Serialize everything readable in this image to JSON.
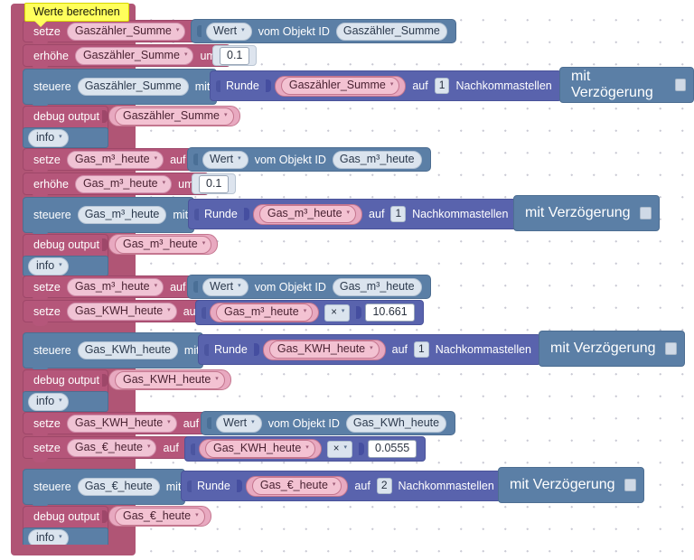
{
  "workspace": {
    "tooltip": "Werte berechnen",
    "colors": {
      "variable_block": "#b5567a",
      "control_block": "#5b7fa6",
      "math_block": "#5963ad",
      "variable_field": "#f0c3d4",
      "object_field": "#dbe4ee",
      "tooltip_bg": "#ffff5c",
      "canvas_bg": "#ffffff"
    },
    "caret_glyph": "▾",
    "multiply_glyph": "×"
  },
  "labels": {
    "setze": "setze",
    "erhoehe": "erhöhe",
    "steuere": "steuere",
    "debug_output": "debug output",
    "auf": "auf",
    "um": "um",
    "mit": "mit",
    "wert": "Wert",
    "vom_objekt_id": "vom Objekt ID",
    "runde": "Runde",
    "auf_nachkomma_pre": "auf",
    "nachkommastellen": "Nachkommastellen",
    "mit_verzoegerung": "mit Verzögerung",
    "info": "info"
  },
  "rows": [
    {
      "id": "row-1",
      "type": "setze-object",
      "variable": "Gaszähler_Summe",
      "value_source": "Wert",
      "object_id": "Gaszähler_Summe"
    },
    {
      "id": "row-2",
      "type": "erhoehe",
      "variable": "Gaszähler_Summe",
      "amount": "0.1"
    },
    {
      "id": "row-3",
      "type": "steuere-runde",
      "variable": "Gaszähler_Summe",
      "round_variable": "Gaszähler_Summe",
      "decimals": "1",
      "delay_checked": false
    },
    {
      "id": "row-4",
      "type": "debug",
      "variable": "Gaszähler_Summe",
      "level": "info"
    },
    {
      "id": "row-5",
      "type": "setze-object",
      "variable": "Gas_m³_heute",
      "value_source": "Wert",
      "object_id": "Gas_m³_heute"
    },
    {
      "id": "row-6",
      "type": "erhoehe",
      "variable": "Gas_m³_heute",
      "amount": "0.1"
    },
    {
      "id": "row-7",
      "type": "steuere-runde",
      "variable": "Gas_m³_heute",
      "round_variable": "Gas_m³_heute",
      "decimals": "1",
      "delay_checked": false
    },
    {
      "id": "row-8",
      "type": "debug",
      "variable": "Gas_m³_heute",
      "level": "info"
    },
    {
      "id": "row-9",
      "type": "setze-object",
      "variable": "Gas_m³_heute",
      "value_source": "Wert",
      "object_id": "Gas_m³_heute"
    },
    {
      "id": "row-10",
      "type": "setze-math",
      "variable": "Gas_KWH_heute",
      "operand_a": "Gas_m³_heute",
      "operator": "×",
      "operand_b": "10.661"
    },
    {
      "id": "row-11",
      "type": "steuere-runde",
      "variable": "Gas_KWh_heute",
      "round_variable": "Gas_KWH_heute",
      "decimals": "1",
      "delay_checked": false
    },
    {
      "id": "row-12",
      "type": "debug",
      "variable": "Gas_KWH_heute",
      "level": "info"
    },
    {
      "id": "row-13",
      "type": "setze-object",
      "variable": "Gas_KWH_heute",
      "value_source": "Wert",
      "object_id": "Gas_KWh_heute"
    },
    {
      "id": "row-14",
      "type": "setze-math",
      "variable": "Gas_€_heute",
      "operand_a": "Gas_KWH_heute",
      "operator": "×",
      "operand_b": "0.0555"
    },
    {
      "id": "row-15",
      "type": "steuere-runde",
      "variable": "Gas_€_heute",
      "round_variable": "Gas_€_heute",
      "decimals": "2",
      "delay_checked": false
    },
    {
      "id": "row-16",
      "type": "debug",
      "variable": "Gas_€_heute",
      "level": "info"
    }
  ]
}
